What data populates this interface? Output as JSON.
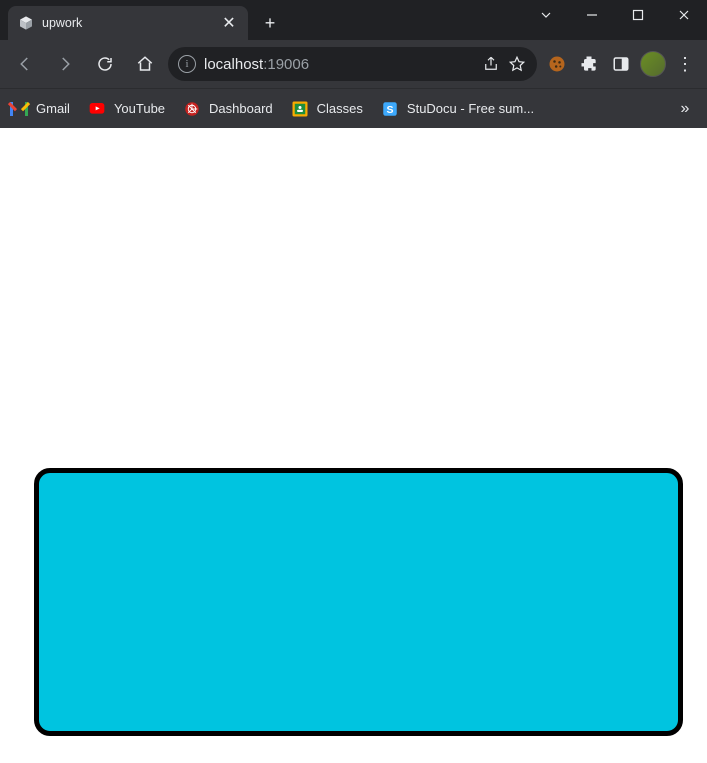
{
  "window": {
    "tab_title": "upwork",
    "controls": {
      "chevron": "⌄",
      "minimize": "—",
      "maximize": "▢",
      "close": "✕"
    }
  },
  "toolbar": {
    "url_host": "localhost",
    "url_port": ":19006",
    "info_glyph": "i",
    "new_tab_glyph": "+",
    "kebab": "⋮",
    "close_glyph": "✕"
  },
  "bookmarks": {
    "items": [
      {
        "label": "Gmail"
      },
      {
        "label": "YouTube"
      },
      {
        "label": "Dashboard"
      },
      {
        "label": "Classes"
      },
      {
        "label": "StuDocu - Free sum..."
      }
    ],
    "overflow": "»"
  },
  "content": {
    "box_color": "#00c4e0"
  }
}
